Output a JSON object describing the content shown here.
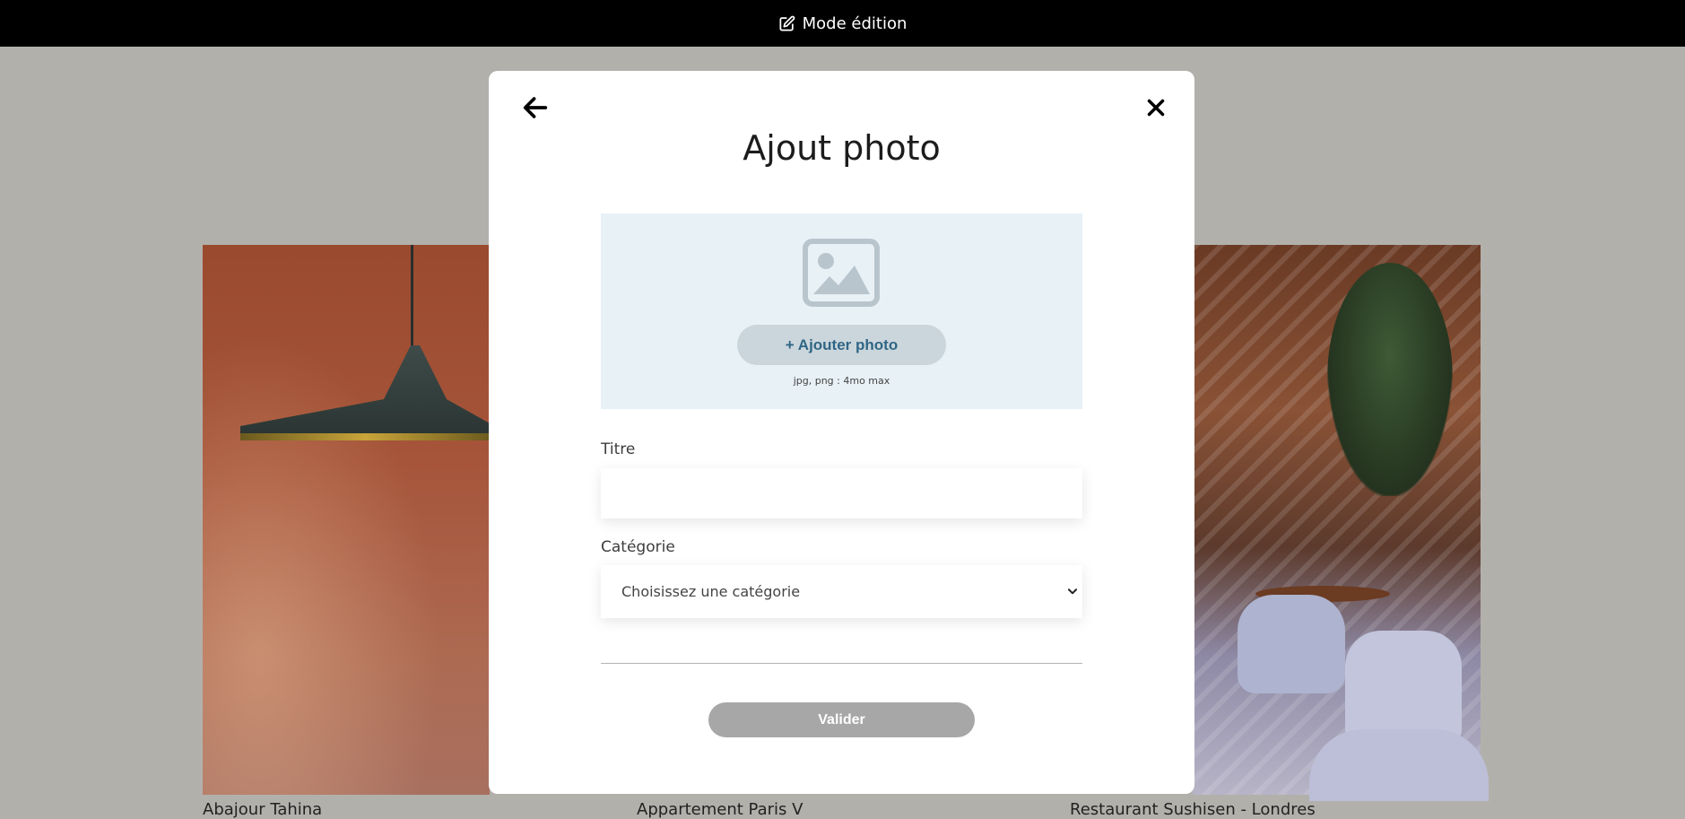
{
  "topbar": {
    "label": "Mode édition",
    "icon": "edit-icon"
  },
  "gallery": {
    "items": [
      {
        "caption": "Abajour Tahina"
      },
      {
        "caption": "Appartement Paris V"
      },
      {
        "caption": "Restaurant Sushisen - Londres"
      }
    ]
  },
  "modal": {
    "title": "Ajout photo",
    "back_icon": "arrow-left-icon",
    "close_icon": "close-icon",
    "upload": {
      "icon": "image-placeholder-icon",
      "button_label": "+ Ajouter photo",
      "hint": "jpg, png : 4mo max"
    },
    "title_field": {
      "label": "Titre",
      "value": ""
    },
    "category_field": {
      "label": "Catégorie",
      "selected": "Choisissez une catégorie",
      "icon": "chevron-down-icon"
    },
    "submit_label": "Valider"
  },
  "colors": {
    "topbar_bg": "#000000",
    "overlay_bg": "#b2b0ab",
    "upload_bg": "#e8f1f6",
    "upload_button_bg": "#cbd6dc",
    "upload_button_text": "#306685",
    "submit_disabled_bg": "#a7a7a7"
  }
}
